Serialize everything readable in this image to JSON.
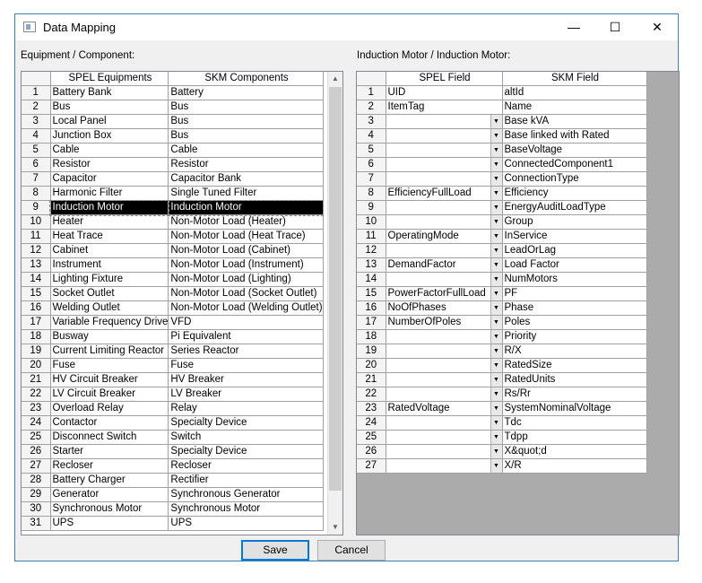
{
  "window": {
    "title": "Data Mapping",
    "minimize_glyph": "—",
    "maximize_glyph": "☐",
    "close_glyph": "✕"
  },
  "left_panel": {
    "label": "Equipment / Component:",
    "columns": [
      "",
      "SPEL Equipments",
      "SKM Components"
    ],
    "selected_row": 9,
    "rows": [
      {
        "n": "1",
        "spel": "Battery Bank",
        "skm": "Battery"
      },
      {
        "n": "2",
        "spel": "Bus",
        "skm": "Bus"
      },
      {
        "n": "3",
        "spel": "Local Panel",
        "skm": "Bus"
      },
      {
        "n": "4",
        "spel": "Junction Box",
        "skm": "Bus"
      },
      {
        "n": "5",
        "spel": "Cable",
        "skm": "Cable"
      },
      {
        "n": "6",
        "spel": "Resistor",
        "skm": "Resistor"
      },
      {
        "n": "7",
        "spel": "Capacitor",
        "skm": "Capacitor Bank"
      },
      {
        "n": "8",
        "spel": "Harmonic Filter",
        "skm": "Single Tuned Filter"
      },
      {
        "n": "9",
        "spel": "Induction Motor",
        "skm": "Induction Motor"
      },
      {
        "n": "10",
        "spel": "Heater",
        "skm": "Non-Motor Load (Heater)"
      },
      {
        "n": "11",
        "spel": "Heat Trace",
        "skm": "Non-Motor Load (Heat Trace)"
      },
      {
        "n": "12",
        "spel": "Cabinet",
        "skm": "Non-Motor Load (Cabinet)"
      },
      {
        "n": "13",
        "spel": "Instrument",
        "skm": "Non-Motor Load (Instrument)"
      },
      {
        "n": "14",
        "spel": "Lighting Fixture",
        "skm": "Non-Motor Load (Lighting)"
      },
      {
        "n": "15",
        "spel": "Socket Outlet",
        "skm": "Non-Motor Load (Socket Outlet)"
      },
      {
        "n": "16",
        "spel": "Welding Outlet",
        "skm": "Non-Motor Load (Welding Outlet)"
      },
      {
        "n": "17",
        "spel": "Variable Frequency Drive",
        "skm": "VFD"
      },
      {
        "n": "18",
        "spel": "Busway",
        "skm": "Pi Equivalent"
      },
      {
        "n": "19",
        "spel": "Current Limiting Reactor",
        "skm": "Series Reactor"
      },
      {
        "n": "20",
        "spel": "Fuse",
        "skm": "Fuse"
      },
      {
        "n": "21",
        "spel": "HV Circuit Breaker",
        "skm": "HV Breaker"
      },
      {
        "n": "22",
        "spel": "LV Circuit Breaker",
        "skm": "LV Breaker"
      },
      {
        "n": "23",
        "spel": "Overload Relay",
        "skm": "Relay"
      },
      {
        "n": "24",
        "spel": "Contactor",
        "skm": "Specialty Device"
      },
      {
        "n": "25",
        "spel": "Disconnect Switch",
        "skm": "Switch"
      },
      {
        "n": "26",
        "spel": "Starter",
        "skm": "Specialty Device"
      },
      {
        "n": "27",
        "spel": "Recloser",
        "skm": "Recloser"
      },
      {
        "n": "28",
        "spel": "Battery Charger",
        "skm": "Rectifier"
      },
      {
        "n": "29",
        "spel": "Generator",
        "skm": "Synchronous Generator"
      },
      {
        "n": "30",
        "spel": "Synchronous Motor",
        "skm": "Synchronous Motor"
      },
      {
        "n": "31",
        "spel": "UPS",
        "skm": "UPS"
      }
    ]
  },
  "right_panel": {
    "label": "Induction Motor / Induction Motor:",
    "columns": [
      "",
      "SPEL Field",
      "SKM Field"
    ],
    "rows": [
      {
        "n": "1",
        "spel": "UID",
        "skm": "altId",
        "dd": false
      },
      {
        "n": "2",
        "spel": "ItemTag",
        "skm": "Name",
        "dd": false
      },
      {
        "n": "3",
        "spel": "",
        "skm": "Base kVA",
        "dd": true
      },
      {
        "n": "4",
        "spel": "",
        "skm": "Base linked with Rated",
        "dd": true
      },
      {
        "n": "5",
        "spel": "",
        "skm": "BaseVoltage",
        "dd": true
      },
      {
        "n": "6",
        "spel": "",
        "skm": "ConnectedComponent1",
        "dd": true
      },
      {
        "n": "7",
        "spel": "",
        "skm": "ConnectionType",
        "dd": true
      },
      {
        "n": "8",
        "spel": "EfficiencyFullLoad",
        "skm": "Efficiency",
        "dd": true
      },
      {
        "n": "9",
        "spel": "",
        "skm": "EnergyAuditLoadType",
        "dd": true
      },
      {
        "n": "10",
        "spel": "",
        "skm": "Group",
        "dd": true
      },
      {
        "n": "11",
        "spel": "OperatingMode",
        "skm": "InService",
        "dd": true
      },
      {
        "n": "12",
        "spel": "",
        "skm": "LeadOrLag",
        "dd": true
      },
      {
        "n": "13",
        "spel": "DemandFactor",
        "skm": "Load Factor",
        "dd": true
      },
      {
        "n": "14",
        "spel": "",
        "skm": "NumMotors",
        "dd": true
      },
      {
        "n": "15",
        "spel": "PowerFactorFullLoad",
        "skm": "PF",
        "dd": true
      },
      {
        "n": "16",
        "spel": "NoOfPhases",
        "skm": "Phase",
        "dd": true
      },
      {
        "n": "17",
        "spel": "NumberOfPoles",
        "skm": "Poles",
        "dd": true
      },
      {
        "n": "18",
        "spel": "",
        "skm": "Priority",
        "dd": true
      },
      {
        "n": "19",
        "spel": "",
        "skm": "R/X",
        "dd": true
      },
      {
        "n": "20",
        "spel": "",
        "skm": "RatedSize",
        "dd": true
      },
      {
        "n": "21",
        "spel": "",
        "skm": "RatedUnits",
        "dd": true
      },
      {
        "n": "22",
        "spel": "",
        "skm": "Rs/Rr",
        "dd": true
      },
      {
        "n": "23",
        "spel": "RatedVoltage",
        "skm": "SystemNominalVoltage",
        "dd": true
      },
      {
        "n": "24",
        "spel": "",
        "skm": "Tdc",
        "dd": true
      },
      {
        "n": "25",
        "spel": "",
        "skm": "Tdpp",
        "dd": true
      },
      {
        "n": "26",
        "spel": "",
        "skm": "X&quot;d",
        "dd": true
      },
      {
        "n": "27",
        "spel": "",
        "skm": "X/R",
        "dd": true
      }
    ]
  },
  "buttons": {
    "save": "Save",
    "cancel": "Cancel"
  }
}
